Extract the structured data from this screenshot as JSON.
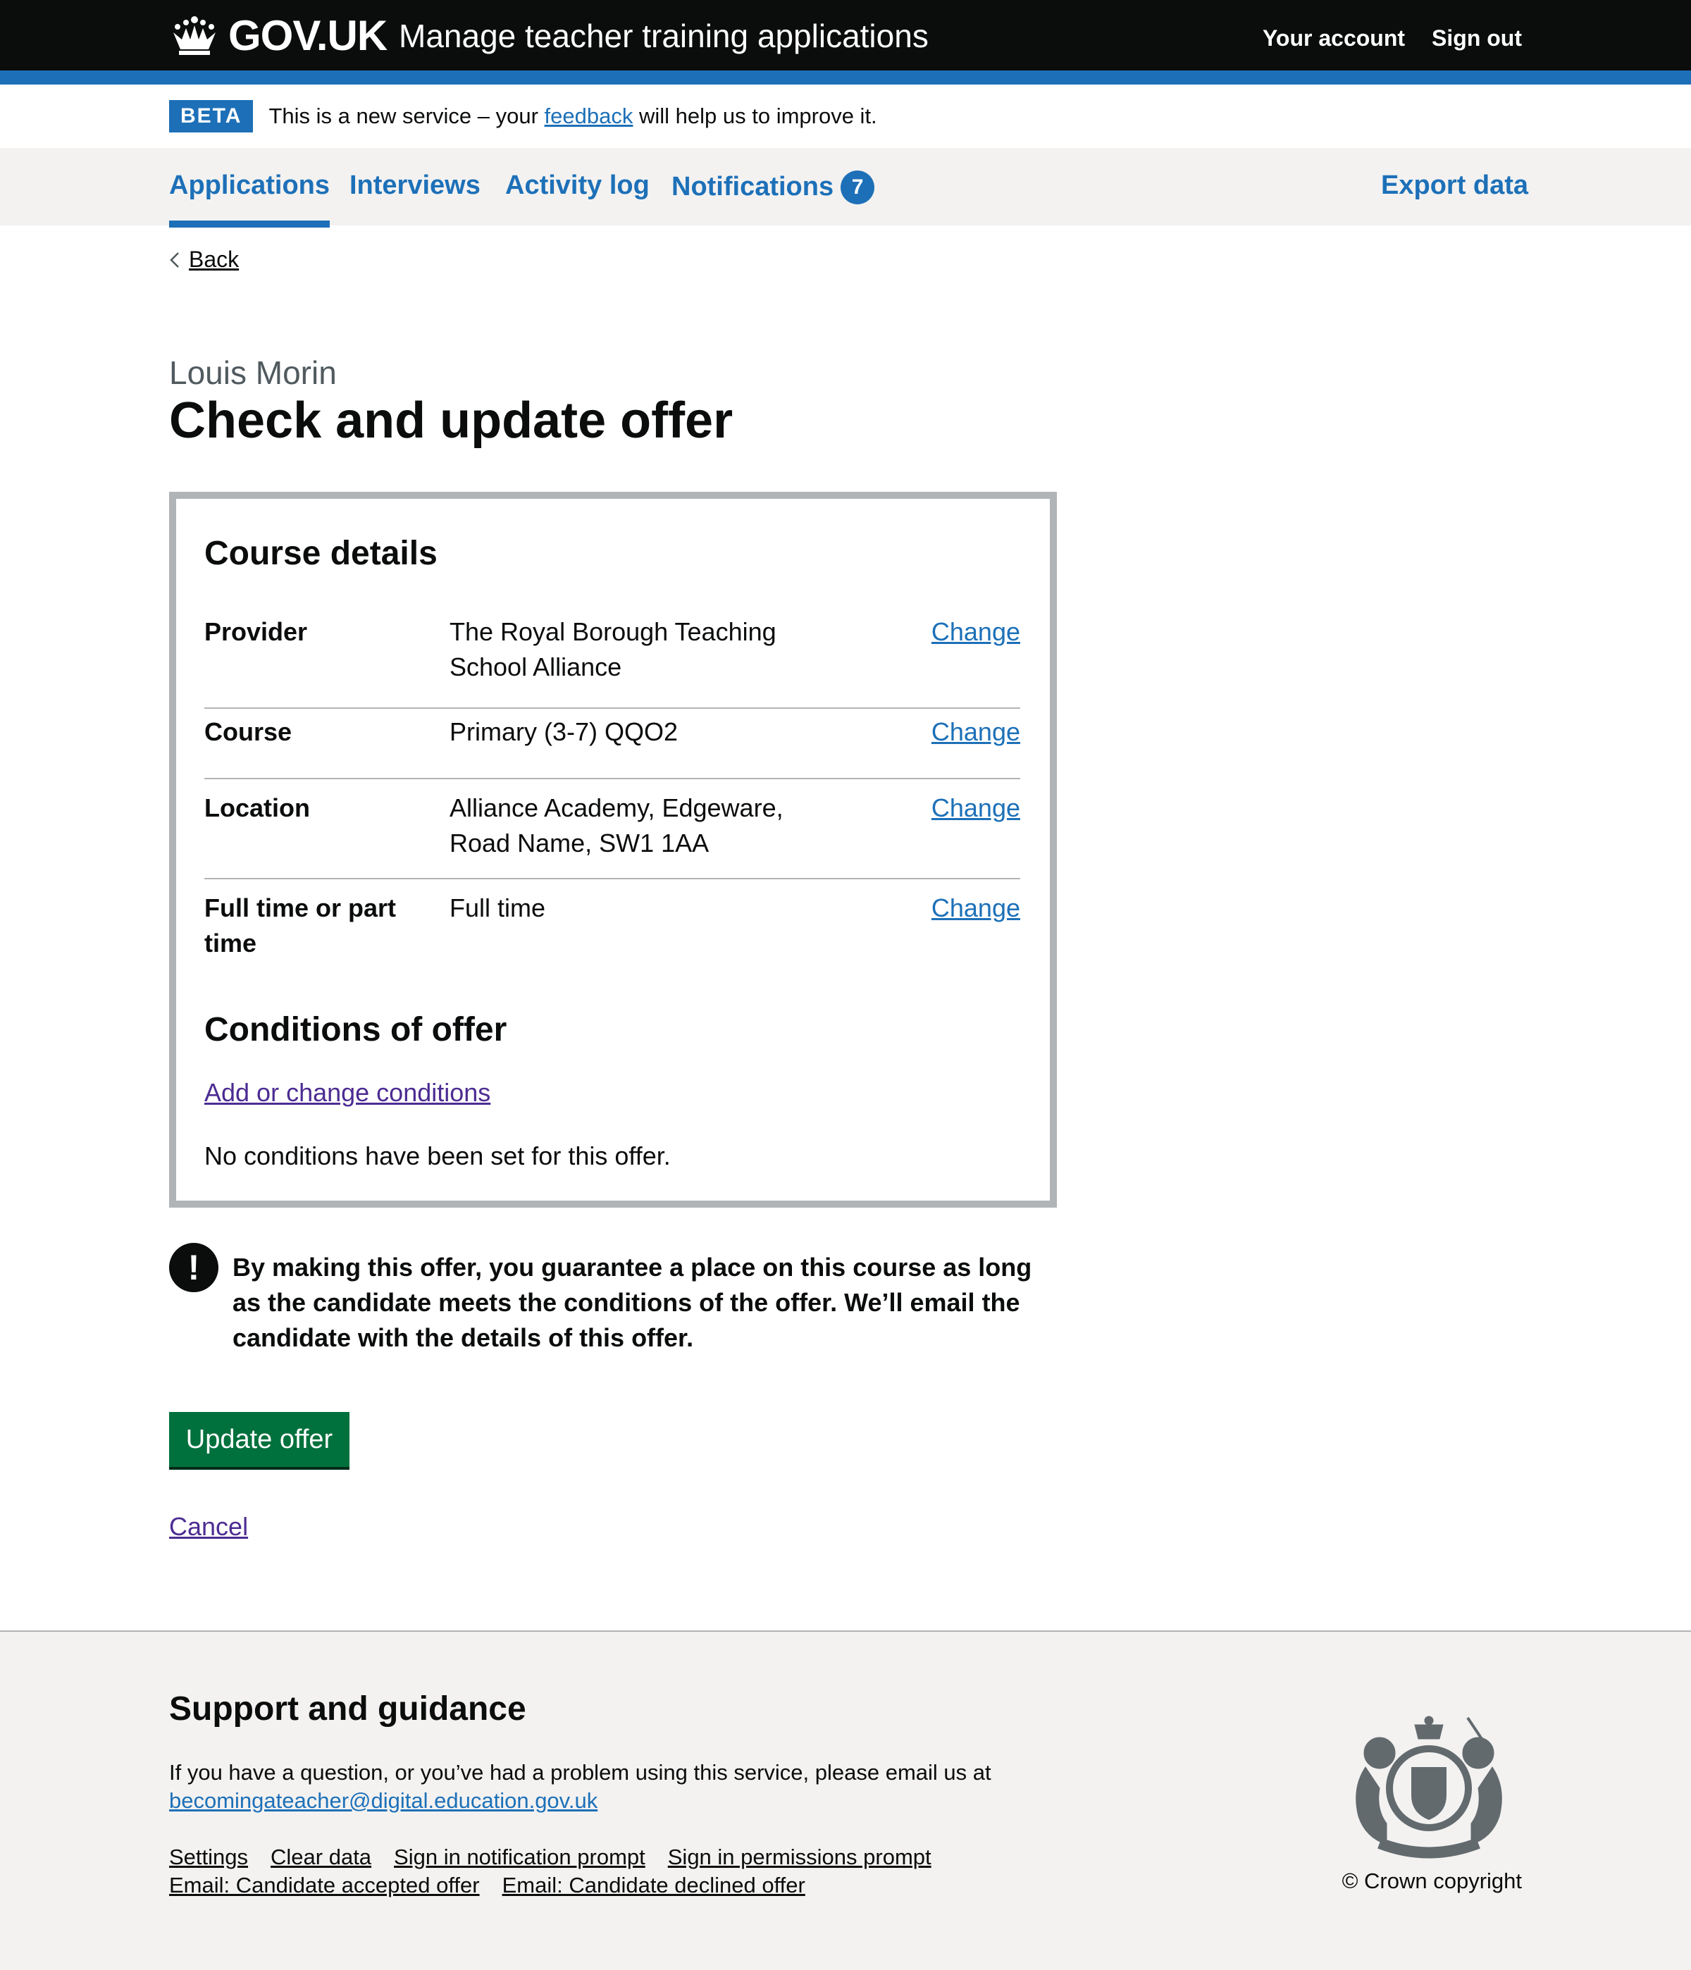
{
  "header": {
    "logo_text": "GOV.UK",
    "service_name": "Manage teacher training applications",
    "links": [
      "Your account",
      "Sign out"
    ]
  },
  "beta_banner": {
    "tag": "BETA",
    "text_before": "This is a new service – your ",
    "link": "feedback",
    "text_after": " will help us to improve it."
  },
  "subnav": {
    "items": [
      {
        "label": "Applications",
        "current": true
      },
      {
        "label": "Interviews"
      },
      {
        "label": "Activity log"
      },
      {
        "label": "Notifications",
        "badge": "7"
      }
    ],
    "export_label": "Export data"
  },
  "back_label": "Back",
  "caption": "Louis Morin",
  "title": "Check and update offer",
  "course_details": {
    "heading": "Course details",
    "rows": [
      {
        "key": "Provider",
        "value": "The Royal Borough Teaching School Alliance",
        "action": "Change"
      },
      {
        "key": "Course",
        "value": "Primary (3-7) QQO2",
        "action": "Change"
      },
      {
        "key": "Location",
        "value": "Alliance Academy, Edgeware, Road Name, SW1 1AA",
        "action": "Change"
      },
      {
        "key": "Full time or part time",
        "value": "Full time",
        "action": "Change"
      }
    ]
  },
  "conditions": {
    "heading": "Conditions of offer",
    "link": "Add or change conditions",
    "text": "No conditions have been set for this offer."
  },
  "warning": {
    "icon": "!",
    "text": "By making this offer, you guarantee a place on this course as long as the candidate meets the conditions of the offer. We’ll email the candidate with the details of this offer."
  },
  "primary_button": "Update offer",
  "cancel_label": "Cancel",
  "footer": {
    "heading": "Support and guidance",
    "text": "If you have a question, or you’ve had a problem using this service, please email us at",
    "email": "becomingateacher@digital.education.gov.uk",
    "links": [
      "Settings",
      "Clear data",
      "Sign in notification prompt",
      "Sign in permissions prompt",
      "Email: Candidate accepted offer",
      "Email: Candidate declined offer"
    ],
    "copyright": "© Crown copyright"
  },
  "colors": {
    "header_bg": "#0b0c0c",
    "brand_blue": "#1d70b8",
    "button_green": "#00703c",
    "visited_link": "#4c2c92",
    "border_grey": "#b1b4b6",
    "light_grey": "#f3f2f1"
  }
}
